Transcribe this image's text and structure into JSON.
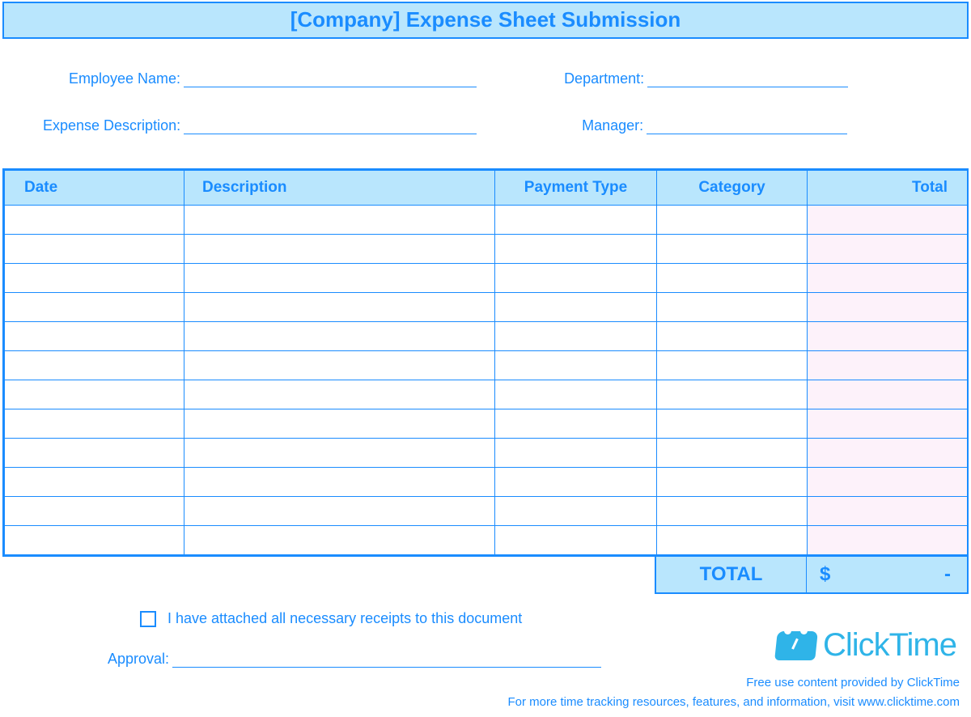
{
  "title": "[Company] Expense Sheet Submission",
  "fields": {
    "employee_name_label": "Employee Name:",
    "department_label": "Department:",
    "expense_description_label": "Expense Description:",
    "manager_label": "Manager:"
  },
  "table": {
    "headers": {
      "date": "Date",
      "description": "Description",
      "payment_type": "Payment Type",
      "category": "Category",
      "total": "Total"
    },
    "row_count": 12
  },
  "grand_total": {
    "label": "TOTAL",
    "currency": "$",
    "value": "-"
  },
  "receipts_checkbox_label": "I have attached all necessary receipts to this document",
  "approval_label": "Approval:",
  "logo": {
    "text": "ClickTime"
  },
  "footer": {
    "line1": "Free use content provided by ClickTime",
    "line2": "For more time tracking resources, features, and information, visit www.clicktime.com"
  }
}
